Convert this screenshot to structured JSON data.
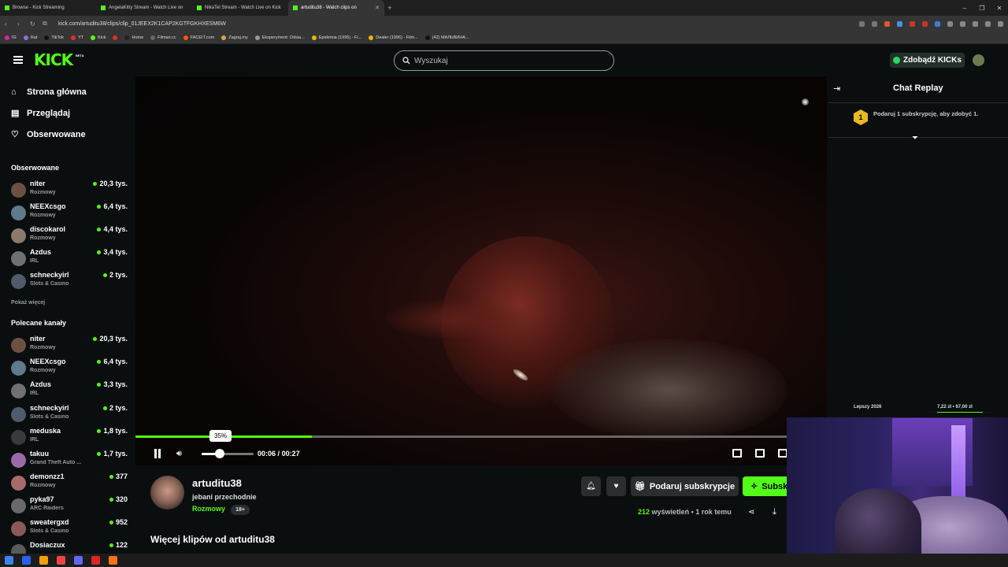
{
  "browser": {
    "tabs": [
      {
        "label": "Browse - Kick Streaming",
        "active": false
      },
      {
        "label": "AngelaKitty Stream - Watch Live on",
        "active": false
      },
      {
        "label": "NikaTel Stream - Watch Live on Kick",
        "active": false
      },
      {
        "label": "artuditu38 - Watch clips on",
        "active": true
      }
    ],
    "url": "kick.com/artuditu38/clips/clip_01JEEX2K1CAP2KGTFGKHXESM6W",
    "bookmarks": [
      "IG",
      "Rat",
      "TikTok",
      "YT",
      "Kick",
      "Home",
      "Filman.cc",
      "FACEIT.com",
      "Zagraj.my",
      "Eksperyment: Odsia...",
      "Epidemia (1995) - Fi...",
      "Dealer (1996) - Film...",
      "(42) МАЛЬВИНА..."
    ]
  },
  "header": {
    "logo": "KICK",
    "logo_badge": "BETA",
    "search_placeholder": "Wyszukaj",
    "get_kicks_label": "Zdobądź KICKs"
  },
  "sidebar": {
    "nav": [
      {
        "label": "Strona główna",
        "icon": "home-icon"
      },
      {
        "label": "Przeglądaj",
        "icon": "browse-icon"
      },
      {
        "label": "Obserwowane",
        "icon": "heart-icon"
      }
    ],
    "followed_heading": "Obserwowane",
    "followed": [
      {
        "name": "niter",
        "category": "Rozmowy",
        "viewers": "20,3 tys."
      },
      {
        "name": "NEEXcsgo",
        "category": "Rozmowy",
        "viewers": "6,4 tys."
      },
      {
        "name": "discokarol",
        "category": "Rozmowy",
        "viewers": "4,4 tys."
      },
      {
        "name": "Azdus",
        "category": "IRL",
        "viewers": "3,4 tys."
      },
      {
        "name": "schneckyirl",
        "category": "Slots & Casino",
        "viewers": "2 tys."
      }
    ],
    "show_more": "Pokaż więcej",
    "recommended_heading": "Polecane kanały",
    "recommended": [
      {
        "name": "niter",
        "category": "Rozmowy",
        "viewers": "20,3 tys."
      },
      {
        "name": "NEEXcsgo",
        "category": "Rozmowy",
        "viewers": "6,4 tys."
      },
      {
        "name": "Azdus",
        "category": "IRL",
        "viewers": "3,3 tys."
      },
      {
        "name": "schneckyirl",
        "category": "Slots & Casino",
        "viewers": "2 tys."
      },
      {
        "name": "meduska",
        "category": "IRL",
        "viewers": "1,8 tys."
      },
      {
        "name": "takuu",
        "category": "Grand Theft Auto ...",
        "viewers": "1,7 tys."
      },
      {
        "name": "demonzz1",
        "category": "Rozmowy",
        "viewers": "377"
      },
      {
        "name": "pyka97",
        "category": "ARC Raiders",
        "viewers": "320"
      },
      {
        "name": "sweatergxd",
        "category": "Slots & Casino",
        "viewers": "952"
      },
      {
        "name": "Dosiaczux",
        "category": "",
        "viewers": "122"
      }
    ]
  },
  "player": {
    "progress_fraction": 0.27,
    "volume_label": "35%",
    "volume_fraction": 0.35,
    "current_time": "00:06",
    "time_separator": "/",
    "duration": "00:27"
  },
  "chat": {
    "title": "Chat Replay",
    "gift_badge_count": "1",
    "gift_prompt": "Podaruj 1 subskrypcję, aby zdobyć 1.",
    "footer_left": "Lepszy 2026",
    "footer_right": "7,22 zł • 67,00 zł"
  },
  "clip_info": {
    "streamer": "artuditu38",
    "title": "jebani przechodnie",
    "category": "Rozmowy",
    "age_badge": "18+",
    "gift_sub_label": "Podaruj subskrypcje",
    "subscribe_label": "Subskrybuj",
    "views_count": "212",
    "views_label": "wyświetleń",
    "posted": "• 1 rok temu",
    "more_clips_heading": "Więcej klipów od artuditu38"
  },
  "colors": {
    "accent": "#53fc18",
    "background": "#0b0e0f",
    "gift_badge": "#e8b923"
  }
}
